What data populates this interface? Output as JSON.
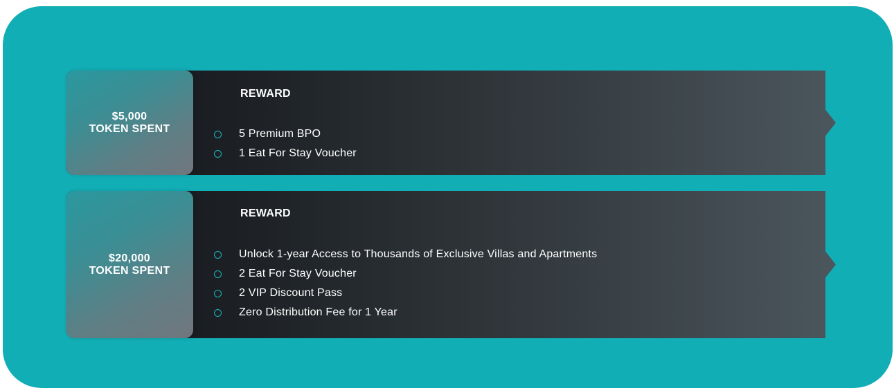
{
  "colors": {
    "panel_background": "#12aeb6",
    "card_dark": "#121417",
    "card_light": "#4b565d",
    "bullet_accent": "#19b7bf",
    "text": "#ffffff"
  },
  "tiers": [
    {
      "amount": "$5,000",
      "label": "TOKEN SPENT",
      "reward_title": "REWARD",
      "rewards": [
        "5 Premium BPO",
        "1 Eat For Stay Voucher"
      ]
    },
    {
      "amount": "$20,000",
      "label": "TOKEN SPENT",
      "reward_title": "REWARD",
      "rewards": [
        "Unlock 1-year Access to Thousands of Exclusive Villas and Apartments",
        "2 Eat For Stay Voucher",
        "2 VIP Discount Pass",
        "Zero Distribution Fee for 1 Year"
      ]
    }
  ],
  "icons": {
    "bullet": "circle-outline-icon"
  }
}
